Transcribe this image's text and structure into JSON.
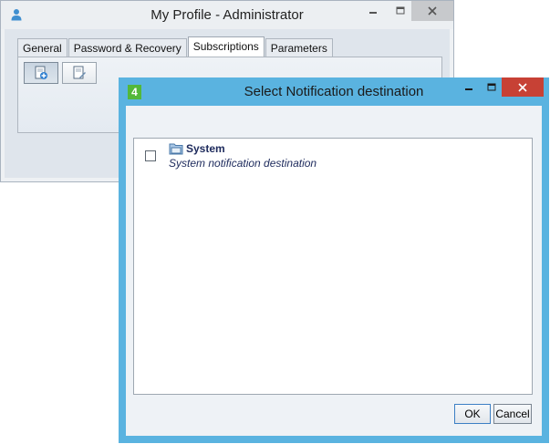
{
  "back_window": {
    "title": "My Profile - Administrator",
    "tabs": [
      {
        "label": "General",
        "active": false
      },
      {
        "label": "Password & Recovery",
        "active": false
      },
      {
        "label": "Subscriptions",
        "active": true
      },
      {
        "label": "Parameters",
        "active": false
      }
    ],
    "toolbar": {
      "add_icon": "add-subscription-icon",
      "edit_icon": "edit-subscription-icon"
    }
  },
  "dialog": {
    "app_icon_text": "4",
    "title": "Select Notification destination",
    "items": [
      {
        "name": "System",
        "description": "System notification destination",
        "checked": false,
        "icon": "folder-icon"
      }
    ],
    "ok_label": "OK",
    "cancel_label": "Cancel"
  },
  "colors": {
    "dialog_frame": "#5ab3e0",
    "close_button": "#c74135",
    "item_text": "#1d2a5c",
    "app_icon": "#53b83a"
  }
}
